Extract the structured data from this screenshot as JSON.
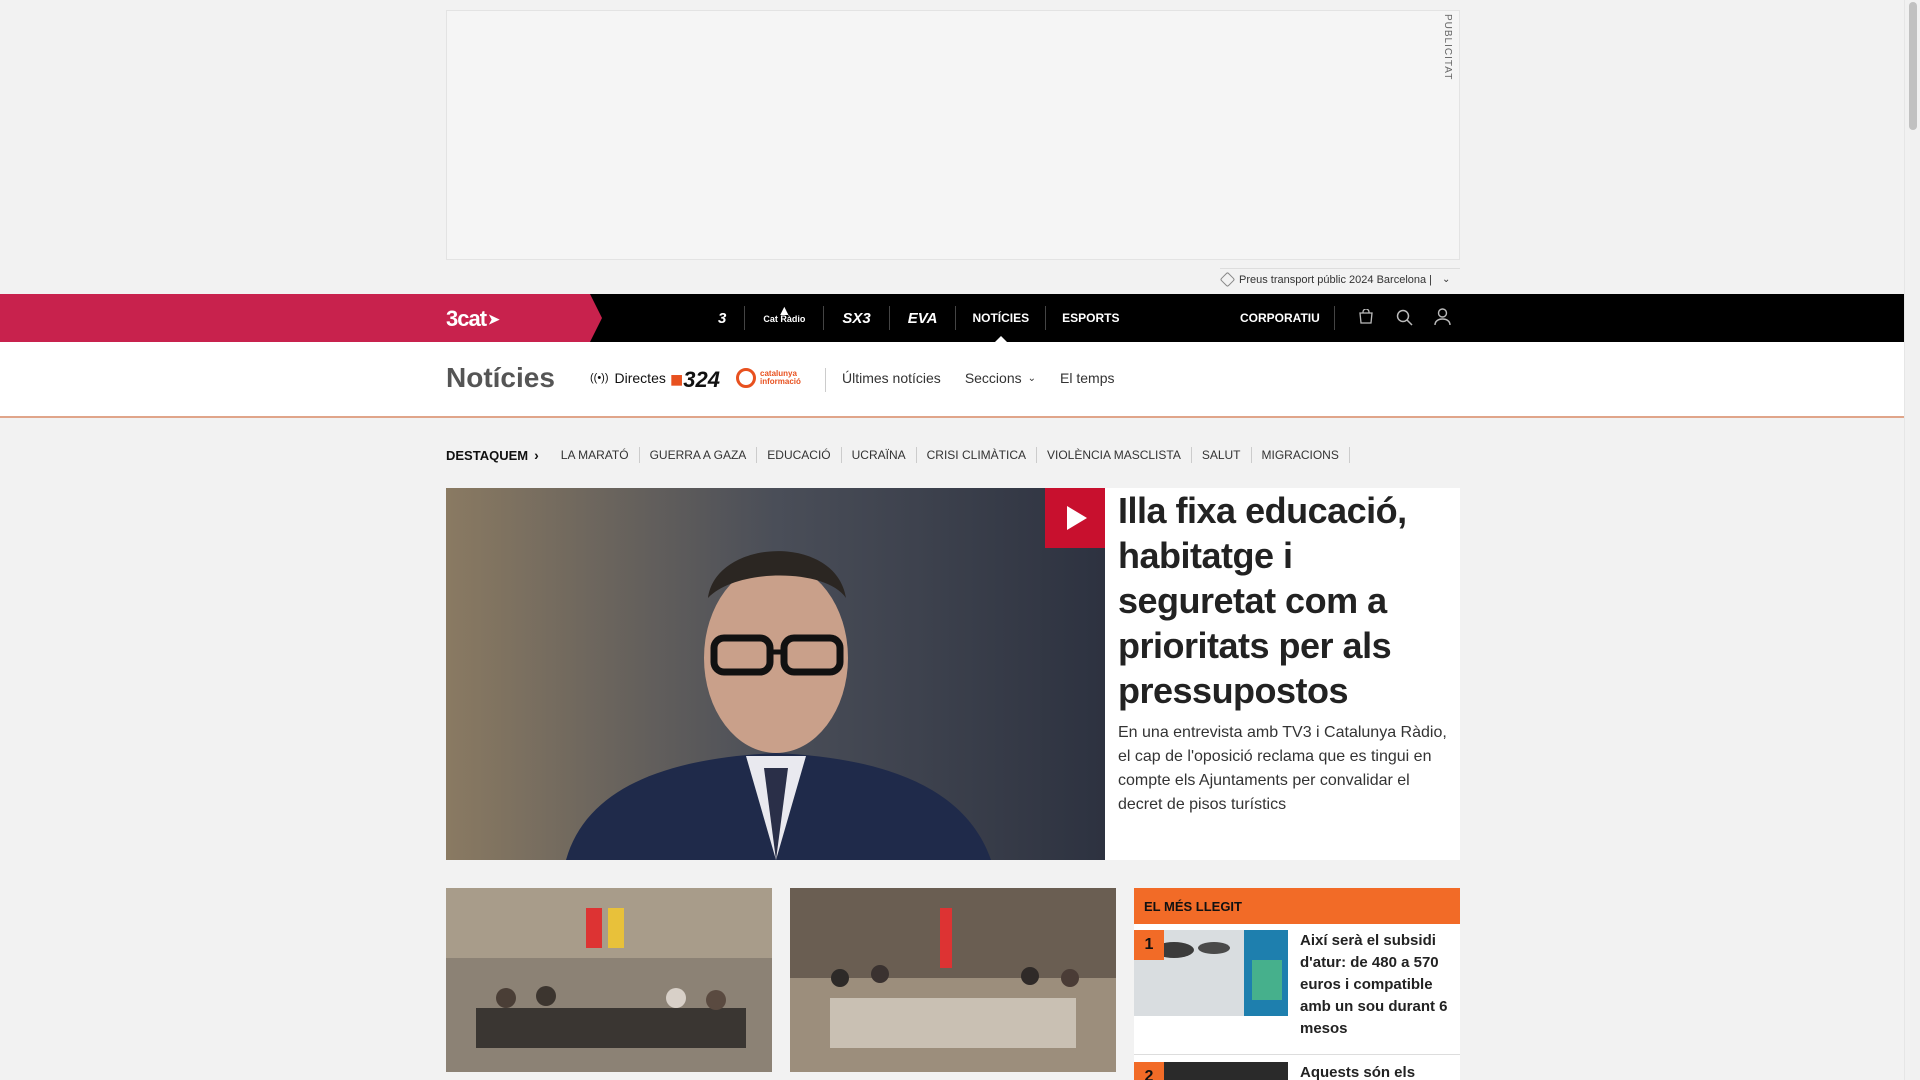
{
  "ad": {
    "label": "PUBLICITAT",
    "tag_text": "Preus transport públic 2024 Barcelona |"
  },
  "topnav": {
    "brand": "3cat",
    "channels": [
      "3",
      "Cat Ràdio",
      "SX3",
      "EVA"
    ],
    "links": [
      "NOTÍCIES",
      "ESPORTS"
    ],
    "active": "NOTÍCIES",
    "corporate": "CORPORATIU",
    "icons": [
      "shop-icon",
      "search-icon",
      "user-icon"
    ]
  },
  "section": {
    "title": "Notícies",
    "directes": "Directes",
    "logo_324": "324",
    "logo_ci_line1": "catalunya",
    "logo_ci_line2": "informació",
    "links": [
      "Últimes notícies",
      "Seccions",
      "El temps"
    ]
  },
  "destaquem": {
    "label": "DESTAQUEM",
    "items": [
      "LA MARATÓ",
      "GUERRA A GAZA",
      "EDUCACIÓ",
      "UCRAÏNA",
      "CRISI CLIMÀTICA",
      "VIOLÈNCIA MASCLISTA",
      "SALUT",
      "MIGRACIONS"
    ]
  },
  "hero": {
    "title": "Illa fixa educació, habitatge i seguretat com a prioritats per als pressupostos",
    "summary": "En una entrevista amb TV3 i Catalunya Ràdio, el cap de l'oposició reclama que es tingui en compte els Ajuntaments per convalidar el decret de pisos turístics"
  },
  "most_read": {
    "title": "EL MÉS LLEGIT",
    "items": [
      {
        "rank": "1",
        "title": "Així serà el subsidi d'atur: de 480 a 570 euros i compatible amb un sou durant 6 mesos"
      },
      {
        "rank": "2",
        "title": "Aquests són els preus"
      }
    ]
  }
}
